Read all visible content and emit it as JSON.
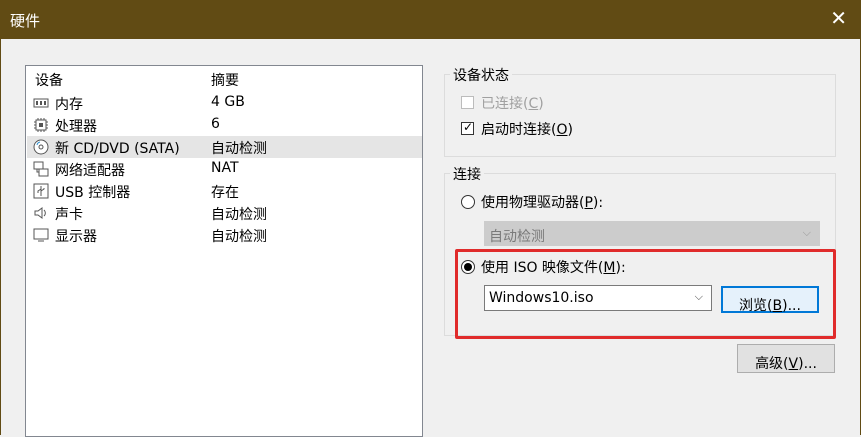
{
  "window": {
    "title": "硬件",
    "close_glyph": "✕"
  },
  "device_list": {
    "columns": {
      "device": "设备",
      "summary": "摘要"
    },
    "items": [
      {
        "name": "内存",
        "summary": "4 GB",
        "icon": "memory-icon"
      },
      {
        "name": "处理器",
        "summary": "6",
        "icon": "cpu-icon"
      },
      {
        "name": "新 CD/DVD (SATA)",
        "summary": "自动检测",
        "icon": "cd-dvd-icon",
        "selected": true
      },
      {
        "name": "网络适配器",
        "summary": "NAT",
        "icon": "network-adapter-icon"
      },
      {
        "name": "USB 控制器",
        "summary": "存在",
        "icon": "usb-icon"
      },
      {
        "name": "声卡",
        "summary": "自动检测",
        "icon": "speaker-icon"
      },
      {
        "name": "显示器",
        "summary": "自动检测",
        "icon": "monitor-icon"
      }
    ]
  },
  "device_status": {
    "label": "设备状态",
    "connected": {
      "label": "已连接(",
      "key": "C",
      "suffix": ")",
      "checked": false,
      "disabled": true
    },
    "connect_at_power_on": {
      "label": "启动时连接(",
      "key": "O",
      "suffix": ")",
      "checked": true
    }
  },
  "connection": {
    "label": "连接",
    "physical": {
      "label": "使用物理驱动器(",
      "key": "P",
      "suffix": "):",
      "selected": false,
      "dropdown_value": "自动检测"
    },
    "iso": {
      "label": "使用 ISO 映像文件(",
      "key": "M",
      "suffix": "):",
      "selected": true,
      "file_value": "Windows10.iso"
    },
    "browse": {
      "label": "浏览(",
      "key": "B",
      "suffix": ")..."
    }
  },
  "advanced": {
    "label": "高级(",
    "key": "V",
    "suffix": ")..."
  },
  "colors": {
    "titlebar": "#614b14",
    "highlight": "#e02b2b",
    "focus": "#0078d7"
  }
}
